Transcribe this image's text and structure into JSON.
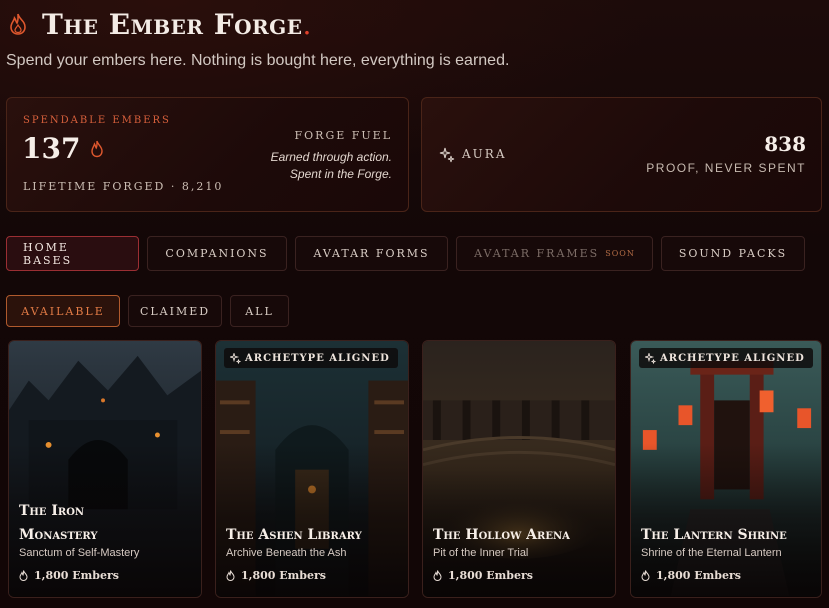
{
  "header": {
    "title": "The Ember Forge",
    "title_dot": ".",
    "subtitle": "Spend your embers here. Nothing is bought here, everything is earned.",
    "icon": "flame-icon"
  },
  "embers_card": {
    "label": "SPENDABLE EMBERS",
    "count": "137",
    "lifetime": "LIFETIME FORGED · 8,210",
    "fuel_title": "FORGE FUEL",
    "fuel_line1": "Earned through action.",
    "fuel_line2": "Spent in the Forge."
  },
  "aura_card": {
    "label": "AURA",
    "value": "838",
    "sub": "PROOF, NEVER SPENT",
    "icon": "sparkle-icon"
  },
  "tabs": [
    {
      "label": "HOME BASES",
      "active": true
    },
    {
      "label": "COMPANIONS",
      "active": false
    },
    {
      "label": "AVATAR FORMS",
      "active": false
    },
    {
      "label": "AVATAR FRAMES",
      "active": false,
      "badge": "SOON"
    },
    {
      "label": "SOUND PACKS",
      "active": false
    }
  ],
  "filters": [
    {
      "label": "AVAILABLE",
      "active": true
    },
    {
      "label": "CLAIMED",
      "active": false
    },
    {
      "label": "ALL",
      "active": false
    }
  ],
  "bases": [
    {
      "name_line1": "The Iron",
      "name_line2": "Monastery",
      "tagline": "Sanctum of Self-Mastery",
      "price": "1,800 Embers",
      "badge": ""
    },
    {
      "name_line1": "",
      "name_line2": "The Ashen Library",
      "tagline": "Archive Beneath the Ash",
      "price": "1,800 Embers",
      "badge": "ARCHETYPE ALIGNED"
    },
    {
      "name_line1": "",
      "name_line2": "The Hollow Arena",
      "tagline": "Pit of the Inner Trial",
      "price": "1,800 Embers",
      "badge": ""
    },
    {
      "name_line1": "",
      "name_line2": "The Lantern Shrine",
      "tagline": "Shrine of the Eternal Lantern",
      "price": "1,800 Embers",
      "badge": "ARCHETYPE ALIGNED"
    }
  ],
  "colors": {
    "accent": "#e0412b",
    "ember": "#d8603c",
    "active_tab_border": "#9b2e33",
    "active_filter": "#e07a45"
  }
}
